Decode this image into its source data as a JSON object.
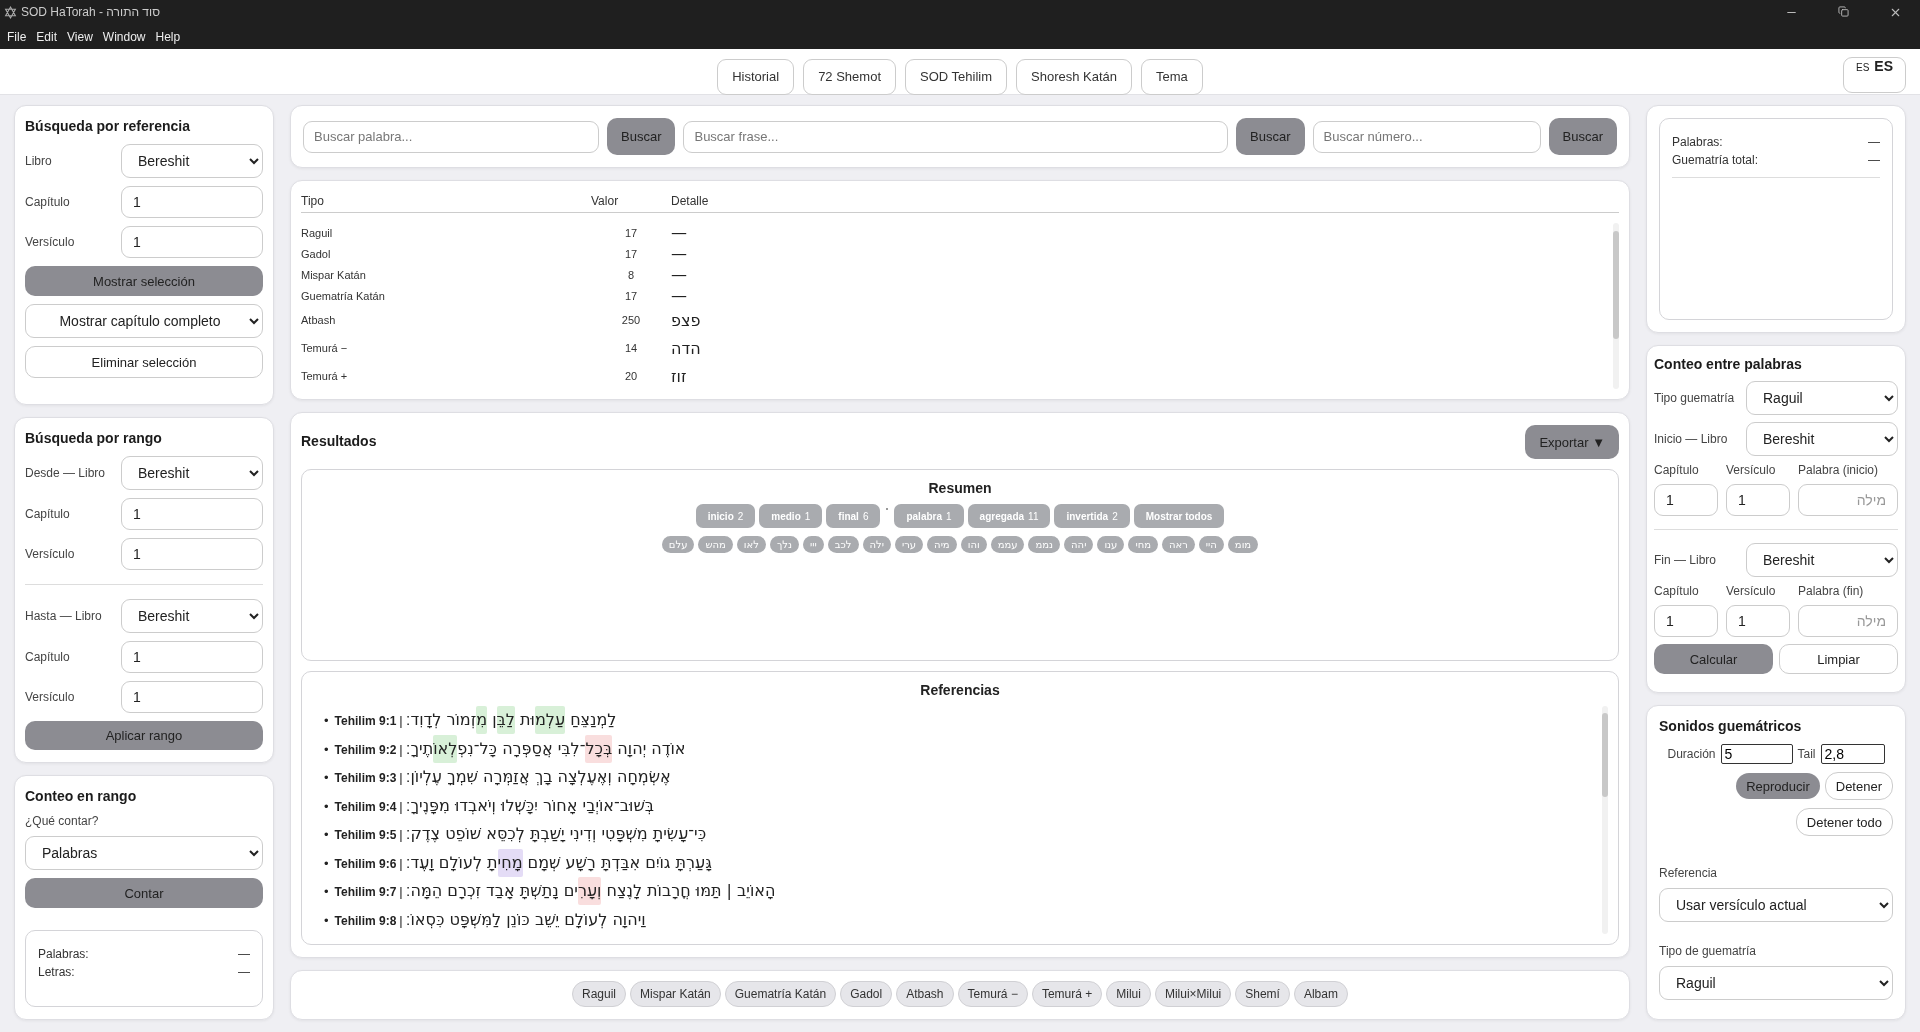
{
  "window": {
    "title": "SOD HaTorah - סוד התורה"
  },
  "menu": [
    "File",
    "Edit",
    "View",
    "Window",
    "Help"
  ],
  "nav": {
    "tabs": [
      "Historial",
      "72 Shemot",
      "SOD Tehilim",
      "Shoresh Katán",
      "Tema"
    ],
    "language": {
      "small": "ES",
      "large": "ES"
    }
  },
  "reference_search": {
    "title": "Búsqueda por referencia",
    "fields": [
      {
        "kind": "select",
        "label": "Libro",
        "value": "Bereshit"
      },
      {
        "kind": "input",
        "label": "Capítulo",
        "value": "1"
      },
      {
        "kind": "input",
        "label": "Versículo",
        "value": "1"
      }
    ],
    "actions": [
      {
        "kind": "primary",
        "label": "Mostrar selección"
      },
      {
        "kind": "select",
        "label": "Mostrar capítulo completo"
      },
      {
        "kind": "outline",
        "label": "Eliminar selección"
      }
    ]
  },
  "range_search": {
    "title": "Búsqueda por rango",
    "from": [
      {
        "kind": "select",
        "label": "Desde — Libro",
        "value": "Bereshit"
      },
      {
        "kind": "input",
        "label": "Capítulo",
        "value": "1"
      },
      {
        "kind": "input",
        "label": "Versículo",
        "value": "1"
      }
    ],
    "to": [
      {
        "kind": "select",
        "label": "Hasta — Libro",
        "value": "Bereshit"
      },
      {
        "kind": "input",
        "label": "Capítulo",
        "value": "1"
      },
      {
        "kind": "input",
        "label": "Versículo",
        "value": "1"
      }
    ],
    "button": "Aplicar rango"
  },
  "range_count": {
    "title": "Conteo en rango",
    "question": "¿Qué contar?",
    "select": "Palabras",
    "button": "Contar",
    "stats": [
      {
        "label": "Palabras:",
        "value": "—"
      },
      {
        "label": "Letras:",
        "value": "—"
      }
    ]
  },
  "search_bar": [
    {
      "placeholder": "Buscar palabra...",
      "button": "Buscar"
    },
    {
      "placeholder": "Buscar frase...",
      "button": "Buscar"
    },
    {
      "placeholder": "Buscar número...",
      "button": "Buscar"
    }
  ],
  "values_table": {
    "columns": [
      "Tipo",
      "Valor",
      "Detalle"
    ],
    "rows": [
      {
        "tipo": "Raguil",
        "valor": "17",
        "detalle": "—"
      },
      {
        "tipo": "Gadol",
        "valor": "17",
        "detalle": "—"
      },
      {
        "tipo": "Mispar Katán",
        "valor": "8",
        "detalle": "—"
      },
      {
        "tipo": "Guematría Katán",
        "valor": "17",
        "detalle": "—"
      },
      {
        "tipo": "Atbash",
        "valor": "250",
        "detalle": "פצפ"
      },
      {
        "tipo": "Temurá −",
        "valor": "14",
        "detalle": "הדה"
      },
      {
        "tipo": "Temurá +",
        "valor": "20",
        "detalle": "זוז"
      }
    ]
  },
  "results": {
    "title": "Resultados",
    "export_button": "Exportar ▼",
    "summary": {
      "title": "Resumen",
      "position_filters": [
        {
          "label": "inicio",
          "count": "2"
        },
        {
          "label": "medio",
          "count": "1"
        },
        {
          "label": "final",
          "count": "6"
        }
      ],
      "word_filters": [
        {
          "label": "palabra",
          "count": "1"
        },
        {
          "label": "agregada",
          "count": "11"
        },
        {
          "label": "invertida",
          "count": "2"
        }
      ],
      "show_all": "Mostrar todos",
      "names": [
        "מומ",
        "היי",
        "ראה",
        "מחי",
        "ענו",
        "יהה",
        "נממ",
        "עממ",
        "והו",
        "מיה",
        "ערי",
        "ילה",
        "לכב",
        "ייי",
        "נלך",
        "לאו",
        "מהש",
        "עלם"
      ]
    },
    "references": {
      "title": "Referencias",
      "separator": "|",
      "bullet": "•",
      "verses": [
        {
          "ref": "Tehilim 9:1",
          "segments": [
            {
              "text": "לַמְנַצֵּחַ "
            },
            {
              "text": "עַלְמ",
              "color": "#d8f0d8"
            },
            {
              "text": "וּת "
            },
            {
              "text": "לַבֵּ",
              "color": "#d8f0d8"
            },
            {
              "text": "ן "
            },
            {
              "text": "מִ",
              "color": "#d8f0d8"
            },
            {
              "text": "זְמוֹר לְדָוִד׃"
            }
          ]
        },
        {
          "ref": "Tehilim 9:2",
          "segments": [
            {
              "text": "אוֹדֶה יְהוָה "
            },
            {
              "text": "בְּכָל",
              "color": "#f9dede"
            },
            {
              "text": "־לִבִּי אֲסַפְּרָה כָּל־נִפְ"
            },
            {
              "text": "לְאוֹ",
              "color": "#d8f0d8"
            },
            {
              "text": "תֶיךָ׃"
            }
          ]
        },
        {
          "ref": "Tehilim 9:3",
          "segments": [
            {
              "text": "אֶשְׂמְחָה וְאֶעֶלְצָה בָךְ אֲזַמְּרָה שִׁמְךָ עֶלְיוֹן׃"
            }
          ]
        },
        {
          "ref": "Tehilim 9:4",
          "segments": [
            {
              "text": "בְּשׁוּב־אוֹיְבַי אָחוֹר יִכָּשְׁלוּ וְיֹאבְדוּ מִפָּנֶיךָ׃"
            }
          ]
        },
        {
          "ref": "Tehilim 9:5",
          "segments": [
            {
              "text": "כִּי־עָשִׂיתָ מִשְׁפָּטִי וְדִינִי יָשַׁבְתָּ לְכִסֵּא שׁוֹפֵט צֶדֶק׃"
            }
          ]
        },
        {
          "ref": "Tehilim 9:6",
          "segments": [
            {
              "text": "גָּעַרְתָּ גוֹיִם אִבַּדְתָּ רָשָׁע שְׁמָם "
            },
            {
              "text": "מָחִי",
              "color": "#e4dcf6"
            },
            {
              "text": "תָ לְעוֹלָם וָעֶד׃"
            }
          ]
        },
        {
          "ref": "Tehilim 9:7",
          "segments": [
            {
              "text": "הָאוֹיֵב | תַּמּוּ חֳרָבוֹת לָנֶצַח "
            },
            {
              "text": "וְעָרִ",
              "color": "#f9dede"
            },
            {
              "text": "ים נָתַשְׁתָּ אָבַד זִכְרָם הֵמָּה׃"
            }
          ]
        },
        {
          "ref": "Tehilim 9:8",
          "segments": [
            {
              "text": "וַיהוָה לְעוֹלָם יֵשֵׁב כּוֹנֵן לַמִּשְׁפָּט כִּסְאוֹ׃"
            }
          ]
        }
      ]
    }
  },
  "gematria_types": [
    "Raguil",
    "Mispar Katán",
    "Guematría Katán",
    "Gadol",
    "Atbash",
    "Temurá −",
    "Temurá +",
    "Milui",
    "Milui×Milui",
    "Shemí",
    "Albam"
  ],
  "word_stats": [
    {
      "label": "Palabras:",
      "value": "—"
    },
    {
      "label": "Guematría total:",
      "value": "—"
    }
  ],
  "word_count": {
    "title": "Conteo entre palabras",
    "type": {
      "label": "Tipo guematría",
      "value": "Raguil"
    },
    "start": {
      "book_label": "Inicio — Libro",
      "book": "Bereshit",
      "fields": [
        {
          "label": "Capítulo",
          "value": "1"
        },
        {
          "label": "Versículo",
          "value": "1"
        },
        {
          "label": "Palabra (inicio)",
          "placeholder": "מילה"
        }
      ]
    },
    "end": {
      "book_label": "Fin — Libro",
      "book": "Bereshit",
      "fields": [
        {
          "label": "Capítulo",
          "value": "1"
        },
        {
          "label": "Versículo",
          "value": "1"
        },
        {
          "label": "Palabra (fin)",
          "placeholder": "מילה"
        }
      ]
    },
    "calculate": "Calcular",
    "clear": "Limpiar"
  },
  "sounds": {
    "title": "Sonidos guemátricos",
    "duration": {
      "label": "Duración",
      "value": "5"
    },
    "tail": {
      "label": "Tail",
      "value": "2,8"
    },
    "play": "Reproducir",
    "stop": "Detener",
    "stop_all": "Detener todo",
    "reference": {
      "label": "Referencia",
      "value": "Usar versículo actual"
    },
    "gematria_type": {
      "label": "Tipo de guematría",
      "value": "Raguil"
    }
  }
}
